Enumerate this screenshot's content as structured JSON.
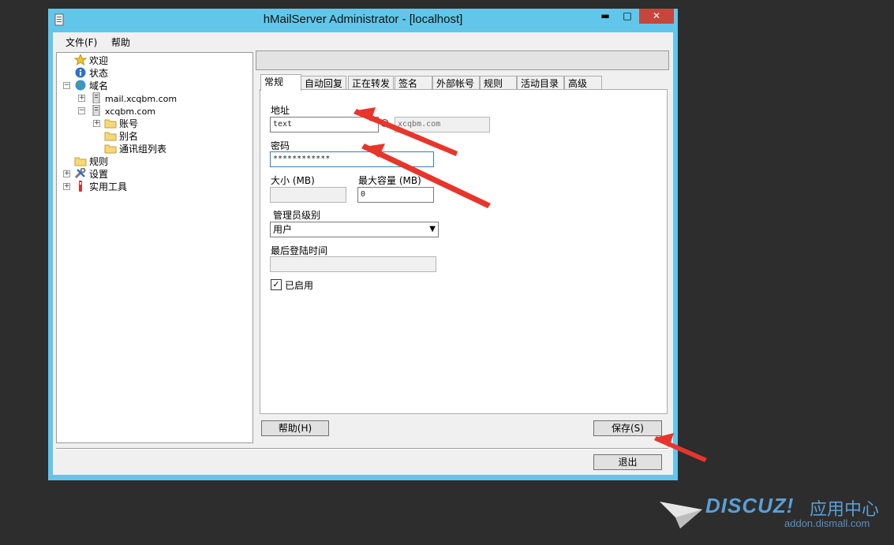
{
  "window": {
    "title": "hMailServer Administrator - [localhost]",
    "controls": {
      "minimize": "▬",
      "maximize": "□",
      "close": "✕"
    }
  },
  "menu": [
    "文件(F)",
    "帮助"
  ],
  "tree": {
    "welcome": "欢迎",
    "status": "状态",
    "domains": "域名",
    "domain1": "mail.xcqbm.com",
    "domain2": "xcqbm.com",
    "accounts": "账号",
    "aliases": "别名",
    "distlists": "通讯组列表",
    "rules": "规则",
    "settings": "设置",
    "utilities": "实用工具"
  },
  "tabs": [
    "常规",
    "自动回复",
    "正在转发",
    "签名",
    "外部帐号",
    "规则",
    "活动目录",
    "高级"
  ],
  "form": {
    "address_label": "地址",
    "address_value": "text",
    "at_sign": "@",
    "domain_value": "xcqbm.com",
    "password_label": "密码",
    "password_value": "************",
    "size_label": "大小 (MB)",
    "size_value": "",
    "maxsize_label": "最大容量 (MB)",
    "maxsize_value": "0",
    "admin_level_label": "管理员级别",
    "admin_level_value": "用户",
    "last_login_label": "最后登陆时间",
    "last_login_value": "",
    "enabled_label": "已启用",
    "enabled": true
  },
  "buttons": {
    "help": "帮助(H)",
    "save": "保存(S)",
    "exit": "退出"
  },
  "watermark": {
    "brand": "DISCUZ!",
    "cn": "应用中心",
    "url": "addon.dismall.com"
  },
  "colors": {
    "window_frame": "#61c6ea",
    "close_button": "#c7463b",
    "annotation_arrow": "#e8352b",
    "background": "#2d2d2d"
  }
}
